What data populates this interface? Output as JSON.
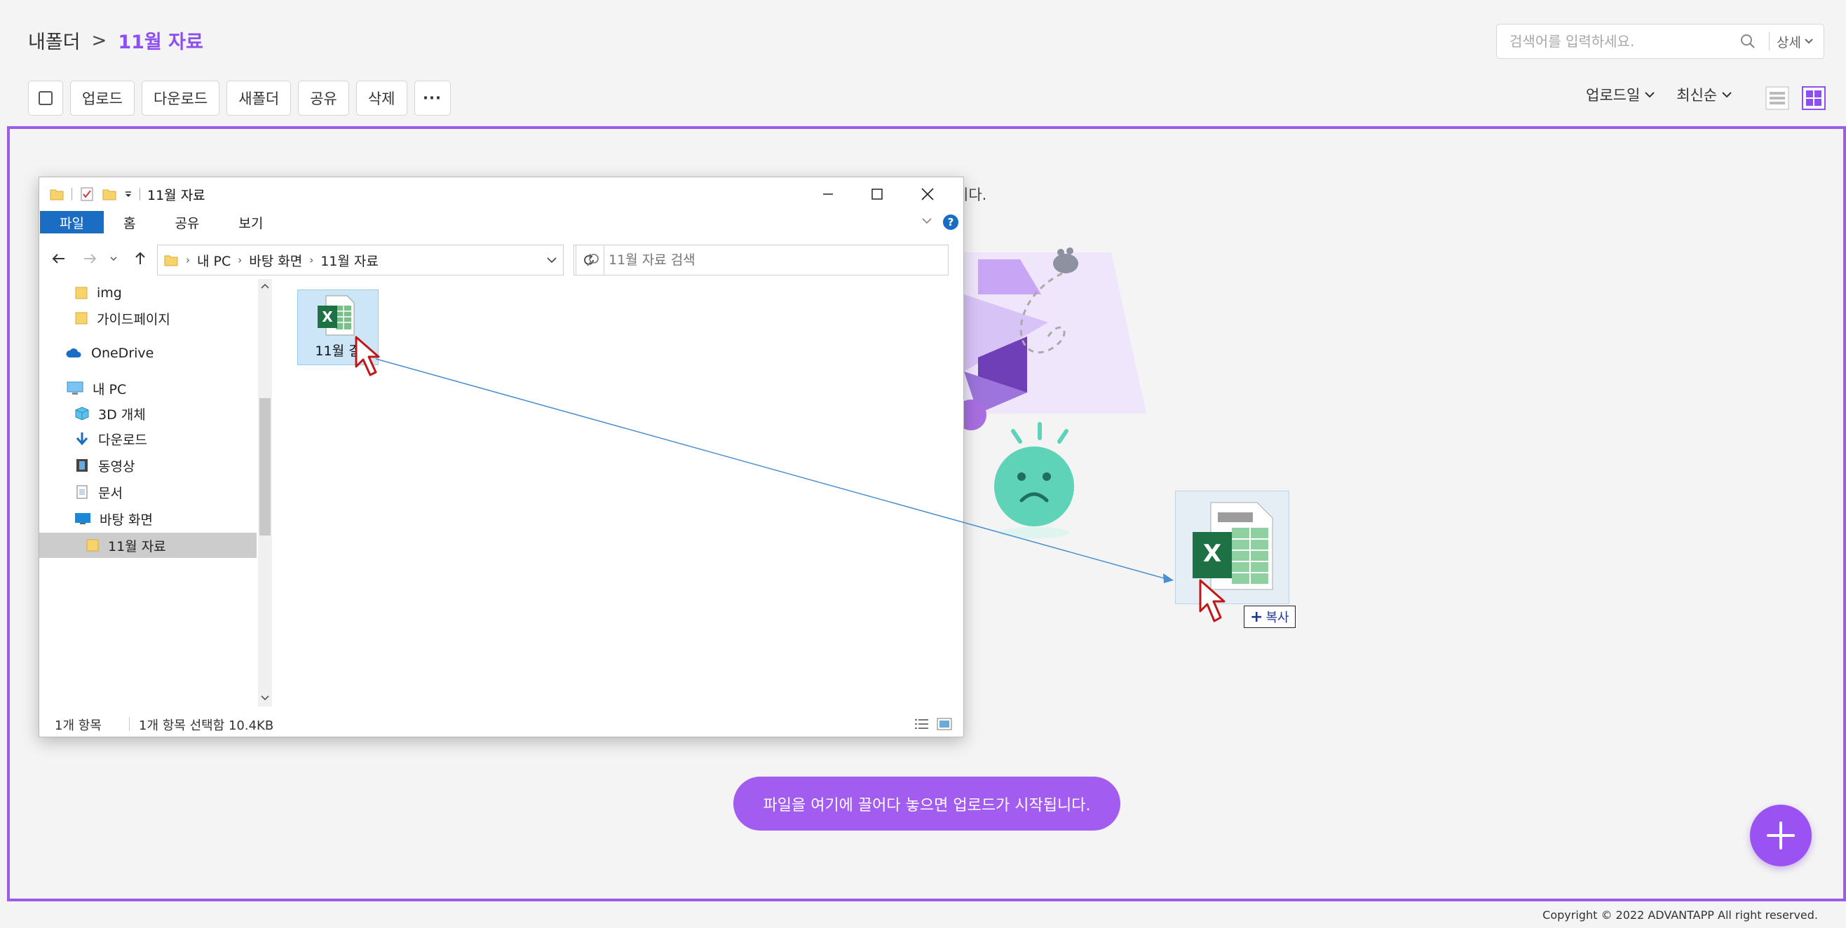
{
  "breadcrumb": {
    "root": "내폴더",
    "separator": ">",
    "current": "11월 자료"
  },
  "search": {
    "placeholder": "검색어를 입력하세요.",
    "detail_label": "상세"
  },
  "toolbar": {
    "upload": "업로드",
    "download": "다운로드",
    "new_folder": "새폴더",
    "share": "공유",
    "delete": "삭제",
    "more": "···"
  },
  "sort": {
    "by": "업로드일",
    "order": "최신순"
  },
  "dropzone": {
    "desc_tail": "니다.",
    "pill": "파일을 여기에 끌어다 놓으면 업로드가 시작됩니다."
  },
  "copyright": "Copyright © 2022 ADVANTAPP All right reserved.",
  "explorer": {
    "title": "11월 자료",
    "ribbon": [
      "파일",
      "홈",
      "공유",
      "보기"
    ],
    "address": [
      "내 PC",
      "바탕 화면",
      "11월 자료"
    ],
    "search_placeholder": "11월 자료 검색",
    "nav": {
      "img": "img",
      "guide": "가이드페이지",
      "onedrive": "OneDrive",
      "pc": "내 PC",
      "objects": "3D 개체",
      "downloads": "다운로드",
      "videos": "동영상",
      "documents": "문서",
      "desktop": "바탕 화면",
      "folder": "11월 자료"
    },
    "file_label": "11월 결",
    "status_count": "1개 항목",
    "status_selected": "1개 항목 선택함 10.4KB"
  },
  "drag": {
    "copy_label": "복사"
  },
  "colors": {
    "accent": "#9b5de8",
    "pill": "#a35cf0",
    "excel": "#1e7145",
    "file_tab": "#1a6dc3"
  }
}
